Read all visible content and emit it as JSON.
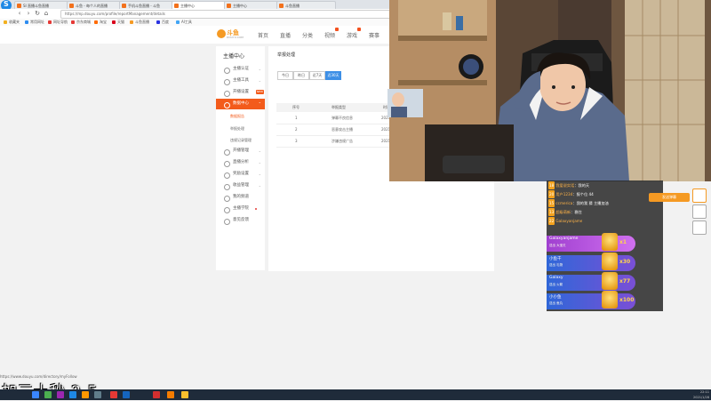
{
  "browser": {
    "tabs": [
      {
        "label": "SI 直播斗鱼直播"
      },
      {
        "label": "斗鱼 - 每个人的直播"
      },
      {
        "label": "手机斗鱼直播 - 斗鱼"
      },
      {
        "label": "主播中心"
      },
      {
        "label": "主播中心"
      },
      {
        "label": "斗鱼直播"
      }
    ],
    "url": "https://mp.douyu.com/profile/reportManagement/details",
    "bookmarks": [
      "收藏夹",
      "常用网址",
      "网址导航",
      "京东商城",
      "淘宝",
      "天猫",
      "斗鱼直播",
      "百度",
      "AI工具"
    ],
    "status_url": "https://www.douyu.com/directory/myFollow"
  },
  "site": {
    "logo_text": "斗鱼",
    "logo_sub": "DOUYU.COM",
    "nav": [
      "首页",
      "直播",
      "分类",
      "视频",
      "游戏",
      "赛事"
    ]
  },
  "sidebar": {
    "title": "主播中心",
    "items": [
      {
        "label": "主播认证"
      },
      {
        "label": "主播工具"
      },
      {
        "label": "开播设置",
        "tag": "NEW"
      },
      {
        "label": "数据中心"
      },
      {
        "label": "开播管理"
      },
      {
        "label": "直播分析"
      },
      {
        "label": "奖励设置"
      },
      {
        "label": "收益管理"
      },
      {
        "label": "我的频道"
      },
      {
        "label": "主播学院"
      },
      {
        "label": "意见反馈"
      }
    ],
    "subitems": [
      "数据报告",
      "举报处理",
      "违规记录管理"
    ]
  },
  "main": {
    "title": "举报处理",
    "segments": [
      "今日",
      "昨日",
      "近7天",
      "近30天"
    ],
    "columns": [
      "序号",
      "举报类型",
      "时间"
    ],
    "rows": [
      {
        "no": "1",
        "type": "弹幕不良信息",
        "time": "2021"
      },
      {
        "no": "2",
        "type": "恶意攻击主播",
        "time": "2021"
      },
      {
        "no": "3",
        "type": "涉嫌违规广告",
        "time": "2021"
      }
    ]
  },
  "chat": {
    "messages": [
      {
        "level": "18",
        "name": "我爱说实话",
        "text": "我的天"
      },
      {
        "level": "20",
        "name": "用户1234",
        "text": "报个位 44"
      },
      {
        "level": "15",
        "name": "ccmerica",
        "text": "我的我 猜 主播加油"
      },
      {
        "level": "13",
        "name": "超级萌新",
        "text": "稳住"
      },
      {
        "level": "22",
        "name": "Galaxyanjame",
        "text": ""
      }
    ],
    "gifts": [
      {
        "name": "Galaxyanjame",
        "sub": "送出 大宝贝",
        "count": "x1",
        "style": "purple"
      },
      {
        "name": "小鱼干",
        "sub": "送出 礼物",
        "count": "x30",
        "style": "blue"
      },
      {
        "name": "Galaxy",
        "sub": "送出 火箭",
        "count": "x77",
        "style": "blue"
      },
      {
        "name": "小小鱼",
        "sub": "送出 鱼丸",
        "count": "x100",
        "style": "blue"
      }
    ],
    "send_label": "发送弹幕"
  },
  "subtitle": "加三十秒 2.5",
  "taskbar": {
    "time": "22:11",
    "date": "2021/1/28"
  },
  "colors": {
    "accent": "#f35b1b",
    "douyu_orange": "#f59a23",
    "selected_blue": "#3d8fe6"
  }
}
